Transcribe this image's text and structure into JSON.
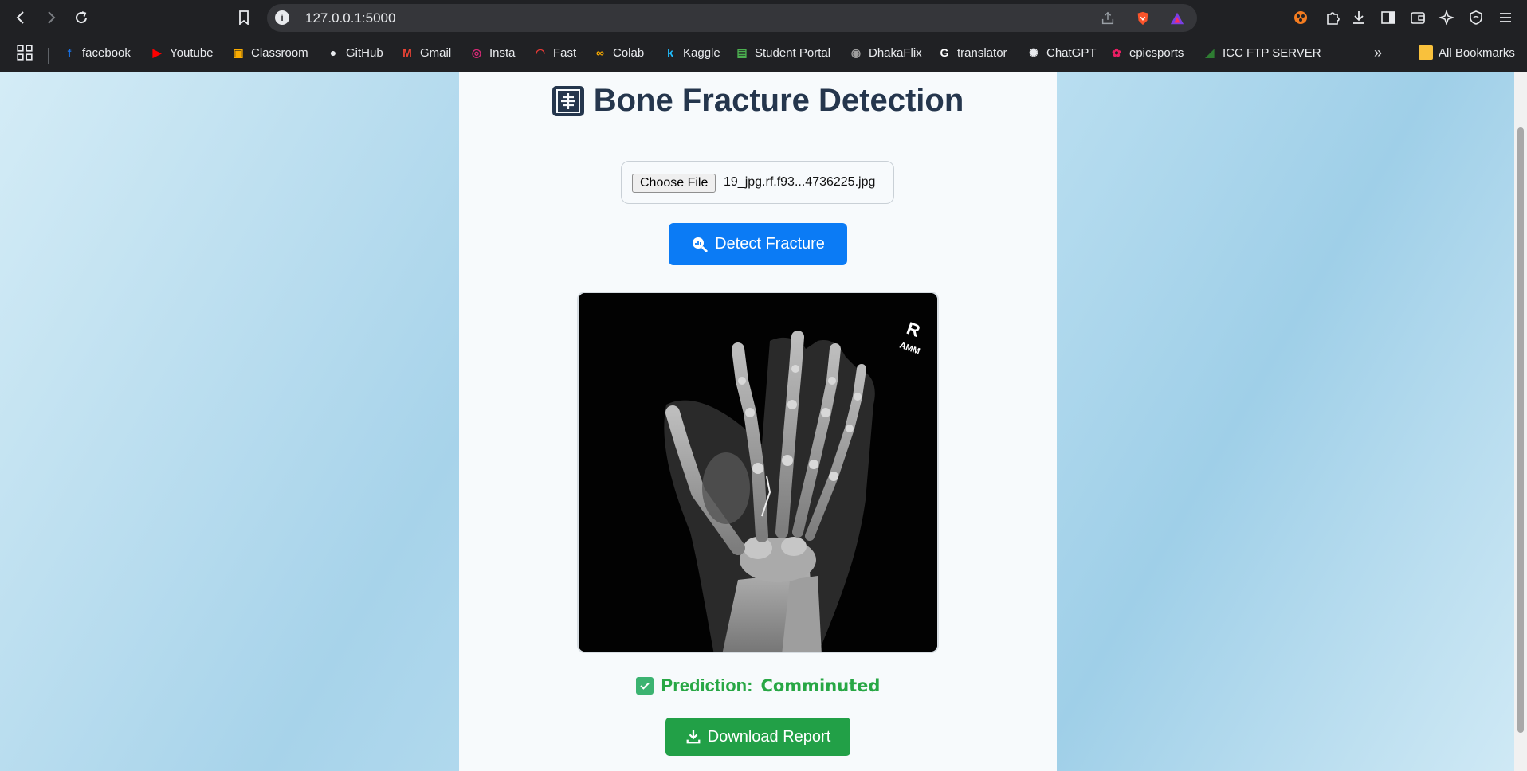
{
  "browser": {
    "url": "127.0.0.1:5000",
    "bookmarks": [
      {
        "label": "facebook",
        "icon": "facebook-icon",
        "color": "#1877f2",
        "glyph": "f"
      },
      {
        "label": "Youtube",
        "icon": "youtube-icon",
        "color": "#ff0000",
        "glyph": "▶"
      },
      {
        "label": "Classroom",
        "icon": "classroom-icon",
        "color": "#f9ab00",
        "glyph": "▣"
      },
      {
        "label": "GitHub",
        "icon": "github-icon",
        "color": "#e8eaed",
        "glyph": "●"
      },
      {
        "label": "Gmail",
        "icon": "gmail-icon",
        "color": "#ea4335",
        "glyph": "M"
      },
      {
        "label": "Insta",
        "icon": "instagram-icon",
        "color": "#d62976",
        "glyph": "◎"
      },
      {
        "label": "Fast",
        "icon": "fast-icon",
        "color": "#e53935",
        "glyph": "◠"
      },
      {
        "label": "Colab",
        "icon": "colab-icon",
        "color": "#f9ab00",
        "glyph": "∞"
      },
      {
        "label": "Kaggle",
        "icon": "kaggle-icon",
        "color": "#20beff",
        "glyph": "k"
      },
      {
        "label": "Student Portal",
        "icon": "student-portal-icon",
        "color": "#4caf50",
        "glyph": "▤"
      },
      {
        "label": "DhakaFlix",
        "icon": "dhakaflix-icon",
        "color": "#9e9e9e",
        "glyph": "◉"
      },
      {
        "label": "translator",
        "icon": "google-icon",
        "color": "#ffffff",
        "glyph": "G"
      },
      {
        "label": "ChatGPT",
        "icon": "chatgpt-icon",
        "color": "#e8eaed",
        "glyph": "✺"
      },
      {
        "label": "epicsports",
        "icon": "epicsports-icon",
        "color": "#e91e63",
        "glyph": "✿"
      },
      {
        "label": "ICC FTP SERVER",
        "icon": "icc-ftp-icon",
        "color": "#2e7d32",
        "glyph": "◢"
      }
    ],
    "more_bookmarks": "»",
    "all_bookmarks": "All Bookmarks"
  },
  "page": {
    "title": "Bone Fracture Detection",
    "file_input": {
      "button_label": "Choose File",
      "file_name": "19_jpg.rf.f93...4736225.jpg"
    },
    "detect_button": "Detect Fracture",
    "prediction_label": "Prediction:",
    "prediction_value": "Comminuted",
    "download_button": "Download Report"
  },
  "colors": {
    "primary_button": "#0b7bf5",
    "success": "#28a745",
    "title": "#25364d"
  }
}
